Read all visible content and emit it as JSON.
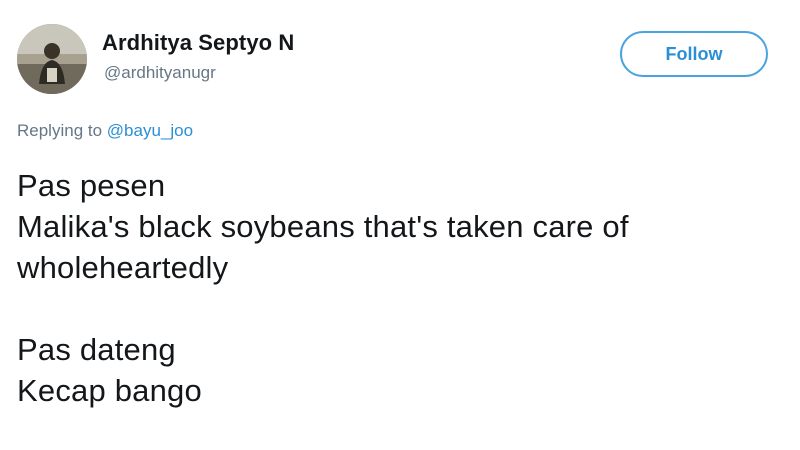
{
  "author": {
    "display_name": "Ardhitya Septyo N",
    "handle": "@ardhityanugr",
    "avatar_icon": "profile-photo"
  },
  "actions": {
    "follow_label": "Follow"
  },
  "reply": {
    "prefix": "Replying to",
    "mention": "@bayu_joo"
  },
  "tweet": {
    "paragraph1": [
      "Pas pesen",
      "Malika's black soybeans that's taken care of",
      "wholeheartedly"
    ],
    "paragraph2": [
      "Pas dateng",
      "Kecap bango"
    ]
  },
  "colors": {
    "accent": "#2b8fd6",
    "text": "#14171a",
    "secondary": "#657786"
  }
}
